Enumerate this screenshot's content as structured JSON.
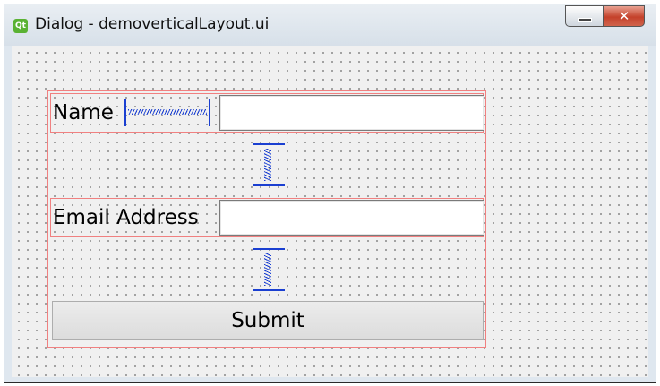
{
  "window": {
    "title": "Dialog - demoverticalLayout.ui",
    "icon": "qt-icon",
    "icon_text": "Qt",
    "close_glyph": "✕"
  },
  "form": {
    "name_label": "Name",
    "name_value": "",
    "email_label": "Email Address",
    "email_value": "",
    "submit_label": "Submit"
  },
  "colors": {
    "layout_outline": "#f08080",
    "spacer": "#1a3fd1"
  }
}
